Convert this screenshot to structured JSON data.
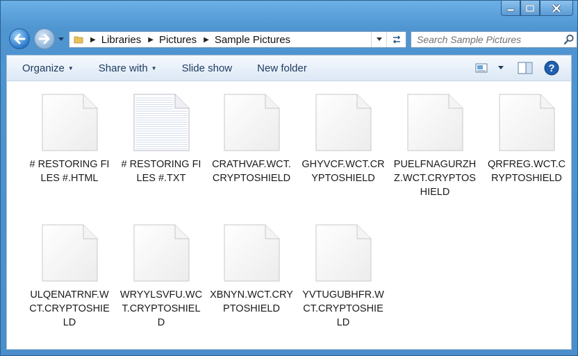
{
  "window": {
    "caption": {
      "minimize": "minimize-icon",
      "maximize": "maximize-icon",
      "close": "close-icon"
    }
  },
  "nav": {
    "breadcrumb": [
      "Libraries",
      "Pictures",
      "Sample Pictures"
    ],
    "search_placeholder": "Search Sample Pictures"
  },
  "toolbar": {
    "organize": "Organize",
    "share_with": "Share with",
    "slide_show": "Slide show",
    "new_folder": "New folder"
  },
  "files": [
    {
      "name": "# RESTORING FILES #.HTML",
      "kind": "blank"
    },
    {
      "name": "# RESTORING FILES #.TXT",
      "kind": "text"
    },
    {
      "name": "CRATHVAF.WCT.CRYPTOSHIELD",
      "kind": "blank"
    },
    {
      "name": "GHYVCF.WCT.CRYPTOSHIELD",
      "kind": "blank"
    },
    {
      "name": "PUELFNAGURZHZ.WCT.CRYPTOSHIELD",
      "kind": "blank"
    },
    {
      "name": "QRFREG.WCT.CRYPTOSHIELD",
      "kind": "blank"
    },
    {
      "name": "ULQENATRNF.WCT.CRYPTOSHIELD",
      "kind": "blank"
    },
    {
      "name": "WRYYLSVFU.WCT.CRYPTOSHIELD",
      "kind": "blank"
    },
    {
      "name": "XBNYN.WCT.CRYPTOSHIELD",
      "kind": "blank"
    },
    {
      "name": "YVTUGUBHFR.WCT.CRYPTOSHIELD",
      "kind": "blank"
    }
  ],
  "colors": {
    "frame": "#4f95d0",
    "toolbar_text": "#1e3a5f",
    "accent": "#2b78c8"
  }
}
